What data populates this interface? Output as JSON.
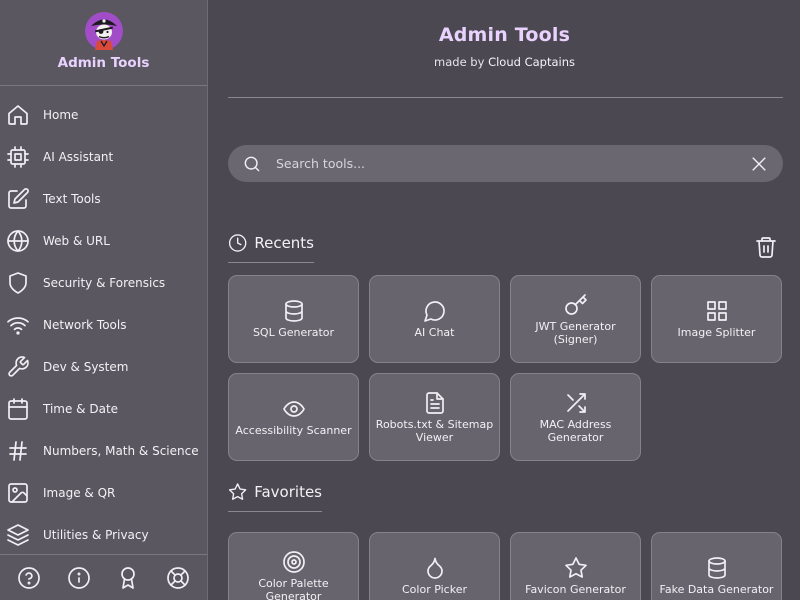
{
  "app": {
    "title": "Admin Tools",
    "subtitle_prefix": "made by",
    "subtitle_author": "Cloud Captains"
  },
  "sidebar": {
    "brand": "Admin Tools",
    "items": [
      {
        "label": "Home",
        "icon": "home-icon"
      },
      {
        "label": "AI Assistant",
        "icon": "chip-icon"
      },
      {
        "label": "Text Tools",
        "icon": "edit-icon"
      },
      {
        "label": "Web & URL",
        "icon": "globe-icon"
      },
      {
        "label": "Security & Forensics",
        "icon": "shield-icon"
      },
      {
        "label": "Network Tools",
        "icon": "wifi-icon"
      },
      {
        "label": "Dev & System",
        "icon": "wrench-icon"
      },
      {
        "label": "Time & Date",
        "icon": "calendar-icon"
      },
      {
        "label": "Numbers, Math & Science",
        "icon": "hash-icon"
      },
      {
        "label": "Image & QR",
        "icon": "image-icon"
      },
      {
        "label": "Utilities & Privacy",
        "icon": "layers-icon"
      }
    ],
    "footer_icons": [
      "help-icon",
      "info-icon",
      "award-icon",
      "lifebuoy-icon"
    ]
  },
  "search": {
    "placeholder": "Search tools...",
    "value": ""
  },
  "recents": {
    "title": "Recents",
    "items": [
      {
        "label": "SQL Generator",
        "icon": "database-icon"
      },
      {
        "label": "AI Chat",
        "icon": "chat-icon"
      },
      {
        "label": "JWT Generator (Signer)",
        "icon": "key-icon"
      },
      {
        "label": "Image Splitter",
        "icon": "grid-icon"
      },
      {
        "label": "Accessibility Scanner",
        "icon": "eye-icon"
      },
      {
        "label": "Robots.txt & Sitemap Viewer",
        "icon": "document-icon"
      },
      {
        "label": "MAC Address Generator",
        "icon": "shuffle-icon"
      }
    ]
  },
  "favorites": {
    "title": "Favorites",
    "items": [
      {
        "label": "Color Palette Generator",
        "icon": "target-icon"
      },
      {
        "label": "Color Picker",
        "icon": "droplet-icon"
      },
      {
        "label": "Favicon Generator",
        "icon": "star-icon"
      },
      {
        "label": "Fake Data Generator",
        "icon": "database-icon"
      }
    ]
  },
  "colors": {
    "accent": "#ead2ff",
    "background": "#4b4851",
    "sidebar": "#5a5760",
    "card": "#67646d"
  }
}
